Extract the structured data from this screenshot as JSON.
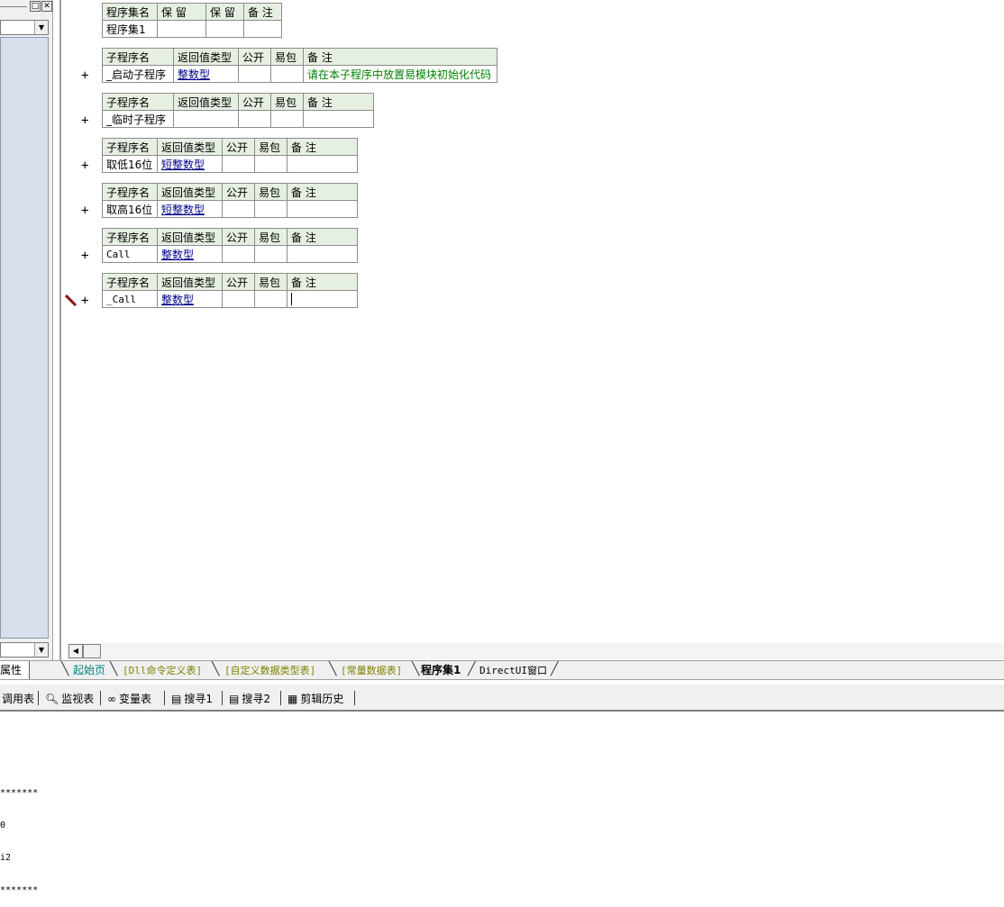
{
  "left_panel": {
    "window_controls": [
      "□",
      "✕"
    ],
    "dropdown_arrow": "▼",
    "attr_tab_label": "属性"
  },
  "editor": {
    "assembly_table": {
      "headers": [
        "程序集名",
        "保 留",
        "保 留",
        "备 注"
      ],
      "row": [
        "程序集1",
        "",
        "",
        ""
      ]
    },
    "sub_tables": [
      {
        "headers": [
          "子程序名",
          "返回值类型",
          "公开",
          "易包",
          "备 注"
        ],
        "name": "_启动子程序",
        "ret_type": "整数型",
        "note": "请在本子程序中放置易模块初始化代码"
      },
      {
        "headers": [
          "子程序名",
          "返回值类型",
          "公开",
          "易包",
          "备 注"
        ],
        "name": "_临时子程序",
        "ret_type": "",
        "note": ""
      },
      {
        "headers": [
          "子程序名",
          "返回值类型",
          "公开",
          "易包",
          "备 注"
        ],
        "name": "取低16位",
        "ret_type": "短整数型",
        "note": ""
      },
      {
        "headers": [
          "子程序名",
          "返回值类型",
          "公开",
          "易包",
          "备 注"
        ],
        "name": "取高16位",
        "ret_type": "短整数型",
        "note": ""
      },
      {
        "headers": [
          "子程序名",
          "返回值类型",
          "公开",
          "易包",
          "备 注"
        ],
        "name": "Call",
        "ret_type": "整数型",
        "note": ""
      },
      {
        "headers": [
          "子程序名",
          "返回值类型",
          "公开",
          "易包",
          "备 注"
        ],
        "name": "_Call",
        "ret_type": "整数型",
        "note": ""
      }
    ],
    "expand_symbol": "+"
  },
  "tabs": [
    {
      "label": "起始页"
    },
    {
      "label": "[Dll命令定义表]"
    },
    {
      "label": "[自定义数据类型表]"
    },
    {
      "label": "[常量数据表]"
    },
    {
      "label": "程序集1"
    },
    {
      "label": "DirectUI窗口"
    }
  ],
  "bottom_toolbar": {
    "items": [
      {
        "label": "调用表",
        "icon": ""
      },
      {
        "label": "监视表",
        "icon": "magnifier-icon"
      },
      {
        "label": "变量表",
        "icon": "variables-icon"
      },
      {
        "label": "搜寻1",
        "icon": "search-doc-icon"
      },
      {
        "label": "搜寻2",
        "icon": "search-doc-icon"
      },
      {
        "label": "剪辑历史",
        "icon": "clipboard-icon"
      }
    ]
  },
  "output": {
    "lines": [
      "*******",
      "0",
      "i2",
      "*******"
    ]
  }
}
